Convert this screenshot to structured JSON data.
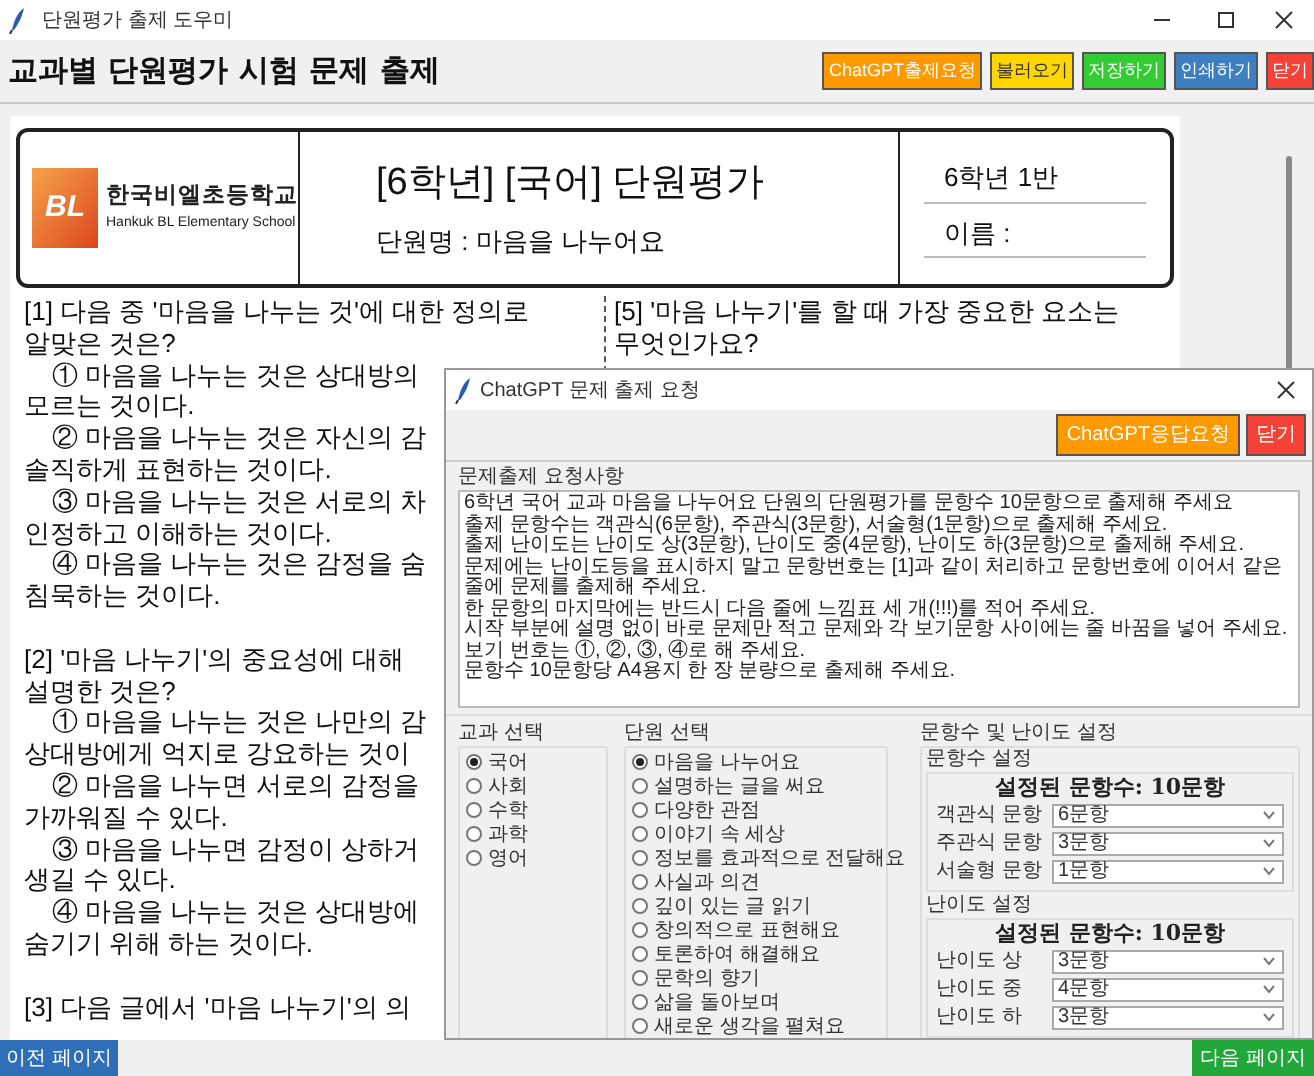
{
  "window": {
    "title": "단원평가 출제 도우미"
  },
  "toolbar": {
    "heading": "교과별 단원평가 시험 문제 출제",
    "buttons": [
      {
        "label": "ChatGPT출제요청",
        "color": "#ff9900"
      },
      {
        "label": "불러오기",
        "color": "#ffd600"
      },
      {
        "label": "저장하기",
        "color": "#33cc33"
      },
      {
        "label": "인쇄하기",
        "color": "#3d7fc1"
      },
      {
        "label": "닫기",
        "color": "#f44336"
      }
    ]
  },
  "page": {
    "school": {
      "logo_text": "BL",
      "name": "한국비엘초등학교",
      "name_en": "Hankuk BL Elementary School"
    },
    "title": "[6학년] [국어] 단원평가",
    "unit": "단원명 : 마음을 나누어요",
    "class": "6학년 1반",
    "name_label": "이름 :",
    "left_column": [
      {
        "lines": [
          {
            "text": "[1] 다음 중 '마음을 나누는 것'에 대한 정의로",
            "kind": "text"
          },
          {
            "text": "알맞은 것은?",
            "kind": "text"
          },
          {
            "text": "① 마음을 나누는 것은 상대방의",
            "kind": "option"
          },
          {
            "text": "모르는 것이다.",
            "kind": "text"
          },
          {
            "text": "② 마음을 나누는 것은 자신의 감",
            "kind": "option"
          },
          {
            "text": "솔직하게 표현하는 것이다.",
            "kind": "text"
          },
          {
            "text": "③ 마음을 나누는 것은 서로의 차",
            "kind": "option"
          },
          {
            "text": "인정하고 이해하는 것이다.",
            "kind": "text"
          },
          {
            "text": "④ 마음을 나누는 것은 감정을 숨",
            "kind": "option"
          },
          {
            "text": "침묵하는 것이다.",
            "kind": "text"
          }
        ]
      },
      {
        "lines": [
          {
            "text": "[2] '마음 나누기'의 중요성에 대해",
            "kind": "text"
          },
          {
            "text": "설명한 것은?",
            "kind": "text"
          },
          {
            "text": "① 마음을 나누는 것은 나만의 감",
            "kind": "option"
          },
          {
            "text": "상대방에게 억지로 강요하는 것이",
            "kind": "text"
          },
          {
            "text": "② 마음을 나누면 서로의 감정을",
            "kind": "option"
          },
          {
            "text": "가까워질 수 있다.",
            "kind": "text"
          },
          {
            "text": "③ 마음을 나누면 감정이 상하거",
            "kind": "option"
          },
          {
            "text": "생길 수 있다.",
            "kind": "text"
          },
          {
            "text": "④ 마음을 나누는 것은 상대방에",
            "kind": "option"
          },
          {
            "text": "숨기기 위해 하는 것이다.",
            "kind": "text"
          }
        ]
      },
      {
        "lines": [
          {
            "text": "[3] 다음 글에서 '마음 나누기'의 의",
            "kind": "text"
          }
        ]
      }
    ],
    "right_column": [
      {
        "lines": [
          {
            "text": "[5] '마음 나누기'를 할 때 가장 중요한 요소는",
            "kind": "text"
          },
          {
            "text": "무엇인가요?",
            "kind": "text"
          }
        ]
      }
    ]
  },
  "nav": {
    "prev": "이전 페이지",
    "next": "다음 페이지"
  },
  "dialog": {
    "title": "ChatGPT 문제 출제 요청",
    "buttons": [
      {
        "label": "ChatGPT응답요청",
        "color": "#ff9900"
      },
      {
        "label": "닫기",
        "color": "#f44336"
      }
    ],
    "request": {
      "label": "문제출제 요청사항",
      "value": "6학년 국어 교과 마음을 나누어요 단원의 단원평가를 문항수 10문항으로 출제해 주세요\n출제 문항수는 객관식(6문항), 주관식(3문항), 서술형(1문항)으로 출제해 주세요.\n출제 난이도는 난이도 상(3문항), 난이도 중(4문항), 난이도 하(3문항)으로 출제해 주세요.\n문제에는 난이도등을 표시하지 말고 문항번호는 [1]과 같이 처리하고 문항번호에 이어서 같은줄에 문제를 출제해 주세요.\n한 문항의 마지막에는 반드시 다음 줄에 느낌표 세 개(!!!)를 적어 주세요.\n시작 부분에 설명 없이 바로 문제만 적고 문제와 각 보기문항 사이에는 줄 바꿈을 넣어 주세요.\n보기 번호는 ①, ②, ③, ④로 해 주세요.\n문항수 10문항당 A4용지 한 장 분량으로 출제해 주세요."
    },
    "subject_group": {
      "label": "교과 선택",
      "options": [
        {
          "label": "국어",
          "selected": true
        },
        {
          "label": "사회",
          "selected": false
        },
        {
          "label": "수학",
          "selected": false
        },
        {
          "label": "과학",
          "selected": false
        },
        {
          "label": "영어",
          "selected": false
        }
      ]
    },
    "unit_group": {
      "label": "단원 선택",
      "options": [
        {
          "label": "마음을 나누어요",
          "selected": true
        },
        {
          "label": "설명하는 글을 써요",
          "selected": false
        },
        {
          "label": "다양한 관점",
          "selected": false
        },
        {
          "label": "이야기 속 세상",
          "selected": false
        },
        {
          "label": "정보를 효과적으로 전달해요",
          "selected": false
        },
        {
          "label": "사실과 의견",
          "selected": false
        },
        {
          "label": "깊이 있는 글 읽기",
          "selected": false
        },
        {
          "label": "창의적으로 표현해요",
          "selected": false
        },
        {
          "label": "토론하여 해결해요",
          "selected": false
        },
        {
          "label": "문학의 향기",
          "selected": false
        },
        {
          "label": "삶을 돌아보며",
          "selected": false
        },
        {
          "label": "새로운 생각을 펼쳐요",
          "selected": false
        }
      ]
    },
    "settings": {
      "label": "문항수 및 난이도 설정",
      "sections": [
        {
          "label": "문항수 설정",
          "total": "설정된 문항수: 10문항",
          "rows": [
            {
              "label": "객관식 문항",
              "value": "6문항"
            },
            {
              "label": "주관식 문항",
              "value": "3문항"
            },
            {
              "label": "서술형 문항",
              "value": "1문항"
            }
          ]
        },
        {
          "label": "난이도 설정",
          "total": "설정된 문항수: 10문항",
          "rows": [
            {
              "label": "난이도 상",
              "value": "3문항"
            },
            {
              "label": "난이도 중",
              "value": "4문항"
            },
            {
              "label": "난이도 하",
              "value": "3문항"
            }
          ]
        }
      ]
    }
  }
}
